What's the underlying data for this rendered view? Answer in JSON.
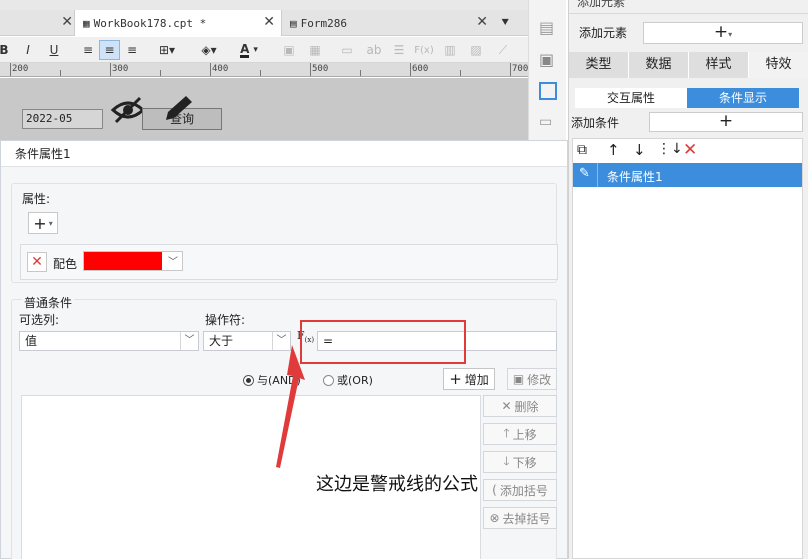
{
  "tabs": [
    {
      "label": "WorkBook178.cpt *"
    },
    {
      "label": "Form286"
    }
  ],
  "toolbar": {
    "bold": "B",
    "italic": "I",
    "underline": "U",
    "font_color": "A",
    "fx": "F(x)",
    "ab": "ab"
  },
  "ruler": {
    "marks": [
      "200",
      "300",
      "400",
      "500",
      "600",
      "700"
    ]
  },
  "form": {
    "date_value": "2022-05",
    "query_button": "查询"
  },
  "dialog": {
    "title": "条件属性1",
    "attributes_label": "属性:",
    "add_plus": "+",
    "color_label": "配色",
    "color_value": "#ff0000",
    "common_conditions_label": "普通条件",
    "column_label": "可选列:",
    "operator_label": "操作符:",
    "column_value": "值",
    "operator_value": "大于",
    "formula_value": "=",
    "and_label": "与(AND)",
    "or_label": "或(OR)",
    "add_button": "增加",
    "modify_button": "修改",
    "delete_button": "删除",
    "up_button": "上移",
    "down_button": "下移",
    "add_paren_button": "添加括号",
    "remove_paren_button": "去掉括号"
  },
  "annotation": "这边是警戒线的公式",
  "right_panel": {
    "title": "添加元素",
    "add_element_label": "添加元素",
    "tabs": [
      "类型",
      "数据",
      "样式",
      "特效"
    ],
    "subtabs": [
      "交互属性",
      "条件显示"
    ],
    "add_condition_label": "添加条件",
    "list_item": "条件属性1"
  },
  "colors": {
    "accent": "#3c8ddc",
    "highlight_red": "#e03a3a"
  }
}
